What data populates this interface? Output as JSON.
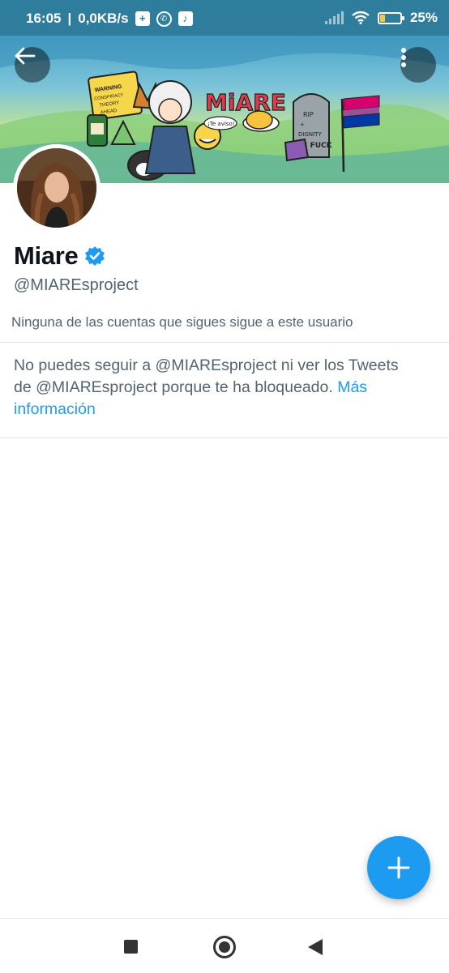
{
  "status_bar": {
    "time": "16:05",
    "speed": "0,0KB/s",
    "battery_percent": "25%",
    "battery_level": 0.25
  },
  "profile": {
    "name": "Miare",
    "handle": "@MIAREsproject",
    "verified": true,
    "followers_note": "Ninguna de las cuentas que sigues sigue a este usuario"
  },
  "blocked": {
    "message": "No puedes seguir a @MIAREsproject ni ver los Tweets de @MIAREsproject porque te ha bloqueado.",
    "link_label": "Más información"
  },
  "banner": {
    "title_text": "MiARE",
    "sign_text": "WARNING CONSPIRACY THEORY AHEAD",
    "tombstone_text": "RIP + DIGNITY AS FUCK",
    "speech_text": "¡Te aviso!"
  },
  "icons": {
    "back": "arrow-left-icon",
    "more": "more-vertical-icon",
    "verified": "verified-badge-icon",
    "compose": "plus-icon"
  },
  "colors": {
    "accent": "#1d9bf0",
    "status_bar": "#2f7d9c",
    "text_primary": "#0f1419",
    "text_secondary": "#536471"
  }
}
